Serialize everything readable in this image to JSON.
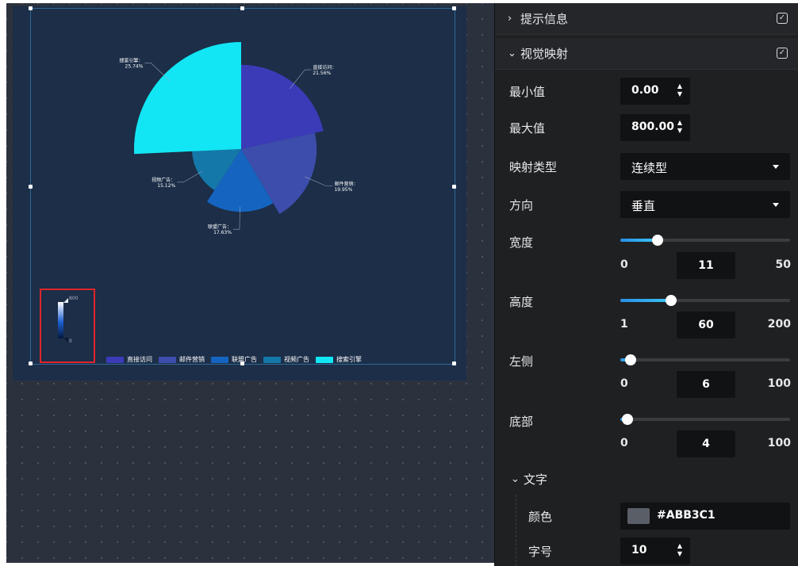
{
  "canvas": {
    "chart": {
      "slices": [
        {
          "name": "直接访问",
          "percent": "21.56%",
          "label": "直接访问：\n21.56%",
          "value": 335,
          "color": "#3b3bb8"
        },
        {
          "name": "邮件营销",
          "percent": "19.95%",
          "label": "邮件营销：\n19.95%",
          "value": 310,
          "color": "#3d4dab"
        },
        {
          "name": "联盟广告",
          "percent": "17.63%",
          "label": "联盟广告：\n17.63%",
          "value": 274,
          "color": "#1565c0"
        },
        {
          "name": "视频广告",
          "percent": "15.12%",
          "label": "视频广告：\n15.12%",
          "value": 235,
          "color": "#1478a8"
        },
        {
          "name": "搜索引擎",
          "percent": "25.74%",
          "label": "搜索引擎：\n25.74%",
          "value": 400,
          "color": "#12e6f5"
        }
      ],
      "visual_map": {
        "max_label": "800",
        "min_label": "0"
      },
      "legend": [
        "直接访问",
        "邮件营销",
        "联盟广告",
        "视频广告",
        "搜索引擎"
      ]
    }
  },
  "panel": {
    "tooltip_group": {
      "title": "提示信息",
      "expanded": false,
      "checked": true
    },
    "visual_map_group": {
      "title": "视觉映射",
      "expanded": true,
      "checked": true
    },
    "min_value": {
      "label": "最小值",
      "value": "0.00"
    },
    "max_value": {
      "label": "最大值",
      "value": "800.00"
    },
    "map_type": {
      "label": "映射类型",
      "value": "连续型"
    },
    "direction": {
      "label": "方向",
      "value": "垂直"
    },
    "width": {
      "label": "宽度",
      "min": "0",
      "value": "11",
      "max": "50",
      "fraction": 0.22
    },
    "height": {
      "label": "高度",
      "min": "1",
      "value": "60",
      "max": "200",
      "fraction": 0.3
    },
    "left": {
      "label": "左侧",
      "min": "0",
      "value": "6",
      "max": "100",
      "fraction": 0.06
    },
    "bottom": {
      "label": "底部",
      "min": "0",
      "value": "4",
      "max": "100",
      "fraction": 0.04
    },
    "text_group": {
      "title": "文字",
      "color": {
        "label": "颜色",
        "value": "#ABB3C1"
      },
      "font_size": {
        "label": "字号",
        "value": "10"
      }
    }
  }
}
